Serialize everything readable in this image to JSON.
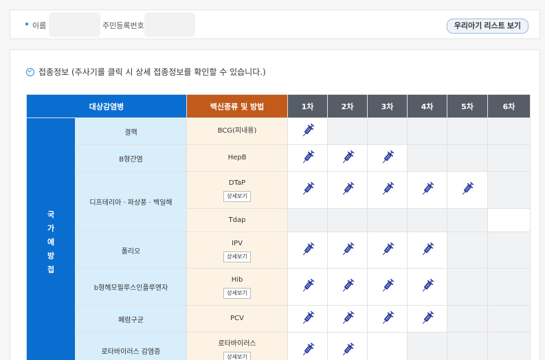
{
  "info": {
    "name_label": "이름 :",
    "rrn_label": "주민등록번호 :",
    "baby_list_button": "우리아기 리스트 보기"
  },
  "section": {
    "title": "접종정보 (주사기를 클릭 시 상세 접종정보를 확인할 수 있습니다.)"
  },
  "table": {
    "headers": {
      "disease": "대상감염병",
      "vaccine": "백신종류 및 방법",
      "doses": [
        "1차",
        "2차",
        "3차",
        "4차",
        "5차",
        "6차"
      ]
    },
    "group_label": "국가예방접",
    "detail_label": "상세보기",
    "rows": [
      {
        "disease": "결핵",
        "vaccine": "BCG(피내용)"
      },
      {
        "disease": "B형간염",
        "vaccine": "HepB"
      },
      {
        "disease": "디프테리아 · 파상풍 · 백일해",
        "vaccine": "DTaP"
      },
      {
        "vaccine": "Tdap"
      },
      {
        "disease": "폴리오",
        "vaccine": "IPV"
      },
      {
        "disease": "b형헤모필루스인플루엔자",
        "vaccine": "Hib"
      },
      {
        "disease": "폐렴구균",
        "vaccine": "PCV"
      },
      {
        "disease": "로타바이러스 감염증",
        "vaccine": "로타바이러스"
      }
    ]
  },
  "colors": {
    "syringe": "#2a3d9e",
    "header_disease": "#0a6ed1",
    "header_vaccine": "#c25a1c",
    "header_dose": "#565d66"
  },
  "icons": {
    "syringe": "syringe-icon",
    "section": "check-circle-icon"
  }
}
